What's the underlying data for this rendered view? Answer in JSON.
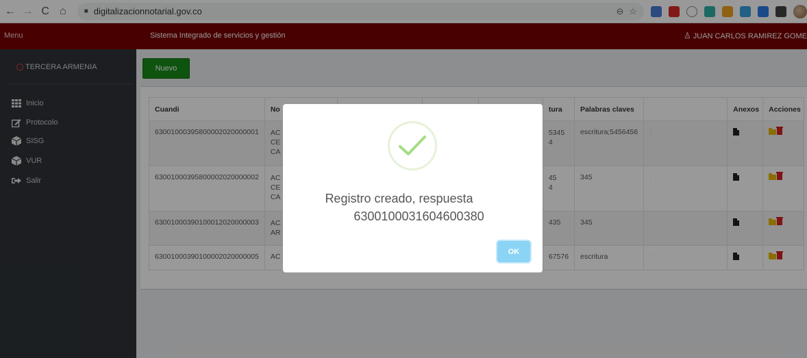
{
  "browser": {
    "url": "digitalizacionnotarial.gov.co"
  },
  "header": {
    "menu_label": "Menu",
    "system_title": "Sistema Integrado de servicios y gestión",
    "user_name": "JUAN CARLOS RAMIREZ GOME"
  },
  "sidebar": {
    "office": "TERCERA ARMENIA",
    "items": [
      {
        "label": "Inicio",
        "icon": "grid-icon"
      },
      {
        "label": "Protocolo",
        "icon": "edit-icon"
      },
      {
        "label": "SISG",
        "icon": "cube-icon"
      },
      {
        "label": "VUR",
        "icon": "cube-icon"
      },
      {
        "label": "Salir",
        "icon": "sign-out-icon"
      }
    ]
  },
  "main": {
    "new_button": "Nuevo",
    "table": {
      "headers": [
        "Cuandi",
        "No",
        "",
        "",
        "",
        "tura",
        "Palabras claves",
        "",
        "Anexos",
        "Acciones"
      ],
      "rows": [
        {
          "cuandi": "63001000395800002020000001",
          "col2": "AC\nCE\nCA",
          "col6": "5345\n4",
          "keywords": "escritura;5456456",
          "col8": ":"
        },
        {
          "cuandi": "63001000395800002020000002",
          "col2": "AC\nCE\nCA",
          "col6": "45\n4",
          "keywords": "345",
          "col8": ":"
        },
        {
          "cuandi": "63001000390100012020000003",
          "col2": "AC\nAR",
          "col6": "435",
          "keywords": "345",
          "col8": ":"
        },
        {
          "cuandi": "63001000390100002020000005",
          "col2": "AC",
          "col6": "67576",
          "keywords": "escritura",
          "col8": ":"
        }
      ]
    }
  },
  "modal": {
    "title_line1": "Registro creado, respuesta",
    "title_line2": "6300100031604600380",
    "ok_label": "OK"
  },
  "colors": {
    "header_bg": "#7a0000",
    "sidebar_bg": "#2f3338",
    "new_button_bg": "#188a18",
    "ok_button_bg": "#8cd4f5",
    "success_check": "#a5dc86"
  }
}
